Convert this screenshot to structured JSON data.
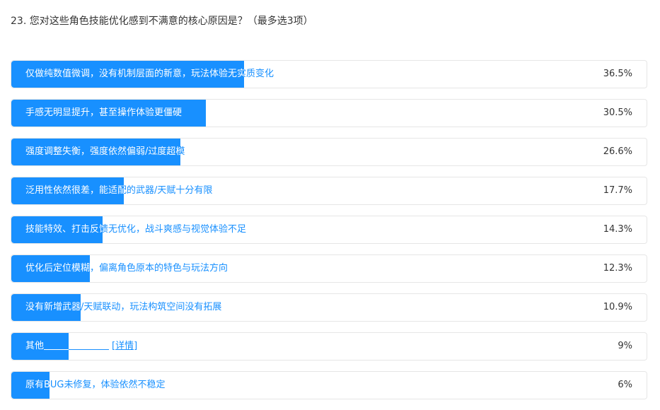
{
  "question": {
    "title": "23. 您对这些角色技能优化感到不满意的核心原因是？（最多选3项）"
  },
  "chart_data": {
    "type": "bar",
    "categories": [
      "仅做纯数值微调，没有机制层面的新意，玩法体验无实质变化",
      "手感无明显提升，甚至操作体验更僵硬",
      "强度调整失衡，强度依然偏弱/过度超模",
      "泛用性依然很差，能适配的武器/天赋十分有限",
      "技能特效、打击反馈无优化，战斗爽感与视觉体验不足",
      "优化后定位模糊，偏离角色原本的特色与玩法方向",
      "没有新增武器/天赋联动，玩法构筑空间没有拓展",
      "其他",
      "原有BUG未修复，体验依然不稳定"
    ],
    "values": [
      36.5,
      30.5,
      26.6,
      17.7,
      14.3,
      12.3,
      10.9,
      9,
      6
    ],
    "value_labels": [
      "36.5%",
      "30.5%",
      "26.6%",
      "17.7%",
      "14.3%",
      "12.3%",
      "10.9%",
      "9%",
      "6%"
    ],
    "bar_color": "#1890ff",
    "other_detail_label": "[详情]"
  }
}
